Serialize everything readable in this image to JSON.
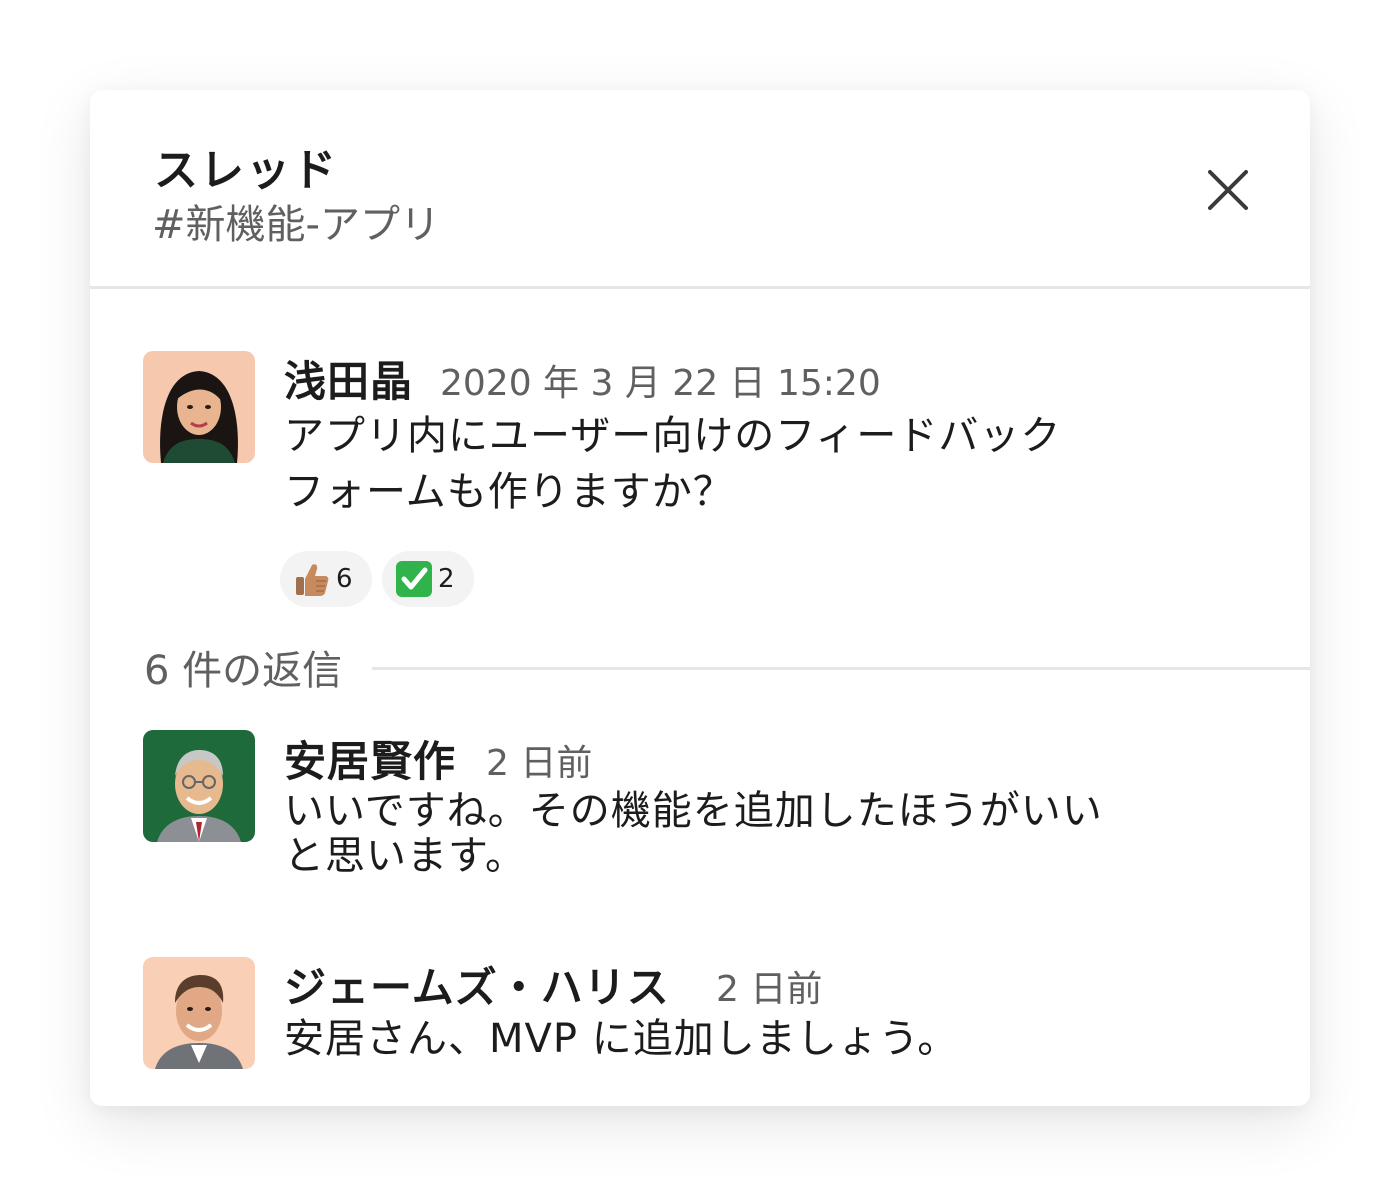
{
  "header": {
    "title": "スレッド",
    "channel": "#新機能-アプリ"
  },
  "parent_message": {
    "author": "浅田晶",
    "timestamp": "2020 年 3 月 22 日 15:20",
    "text_line1": "アプリ内にユーザー向けのフィードバック",
    "text_line2": "フォームも作りますか？",
    "reactions": [
      {
        "icon": "thumbs-up-icon",
        "count": "6"
      },
      {
        "icon": "check-mark-icon",
        "count": "2"
      }
    ]
  },
  "replies": {
    "label": "6 件の返信",
    "items": [
      {
        "author": "安居賢作",
        "timestamp": "2 日前",
        "text_line1": "いいですね。その機能を追加したほうがいい",
        "text_line2": "と思います。"
      },
      {
        "author": "ジェームズ・ハリス",
        "timestamp": "2 日前",
        "text_line1": "安居さん、MVP に追加しましょう。"
      }
    ]
  },
  "colors": {
    "text_primary": "#1d1c1d",
    "text_secondary": "#616061",
    "divider": "#e6e6e6",
    "reaction_bg": "#f3f3f3"
  }
}
